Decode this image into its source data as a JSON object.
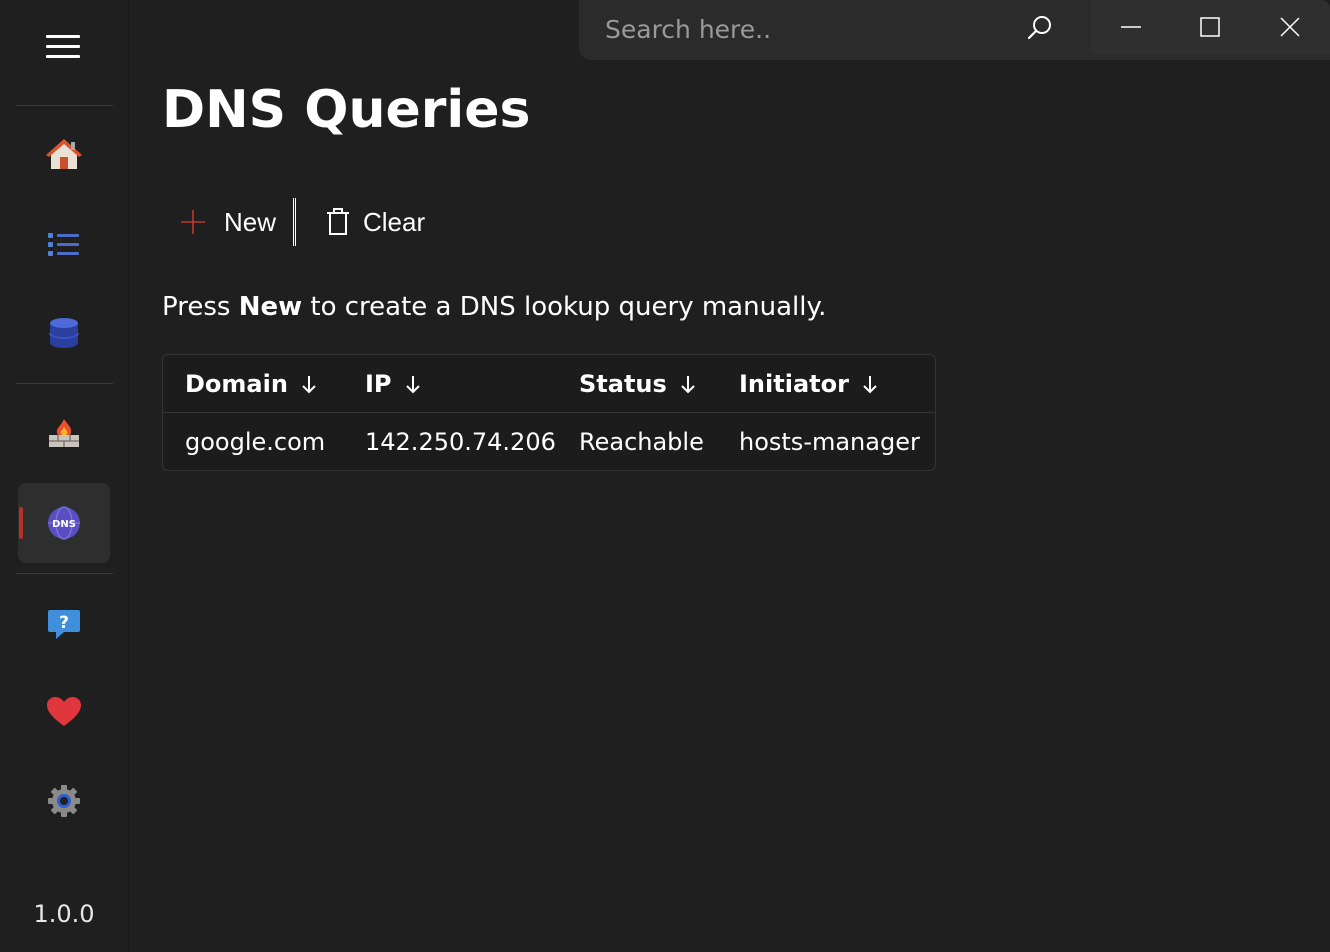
{
  "app": {
    "version": "1.0.0"
  },
  "search": {
    "placeholder": "Search here.."
  },
  "sidebar": {
    "items": [
      {
        "name": "home",
        "icon": "house-icon"
      },
      {
        "name": "list",
        "icon": "list-icon"
      },
      {
        "name": "database",
        "icon": "database-icon"
      },
      {
        "name": "firewall",
        "icon": "firewall-icon"
      },
      {
        "name": "dns",
        "icon": "dns-globe-icon",
        "icon_text": "DNS",
        "active": true
      },
      {
        "name": "help",
        "icon": "help-icon"
      },
      {
        "name": "favorites",
        "icon": "heart-icon"
      },
      {
        "name": "settings",
        "icon": "gear-icon"
      }
    ]
  },
  "page": {
    "title": "DNS Queries",
    "info_prefix": "Press ",
    "info_bold": "New",
    "info_suffix": " to create a DNS lookup query manually."
  },
  "toolbar": {
    "new_label": "New",
    "clear_label": "Clear"
  },
  "table": {
    "columns": [
      "Domain",
      "IP",
      "Status",
      "Initiator"
    ],
    "rows": [
      [
        "google.com",
        "142.250.74.206",
        "Reachable",
        "hosts-manager"
      ]
    ]
  },
  "colors": {
    "background": "#1f1f1f",
    "accent": "#b3332b",
    "search_bg": "#2b2b2b"
  }
}
